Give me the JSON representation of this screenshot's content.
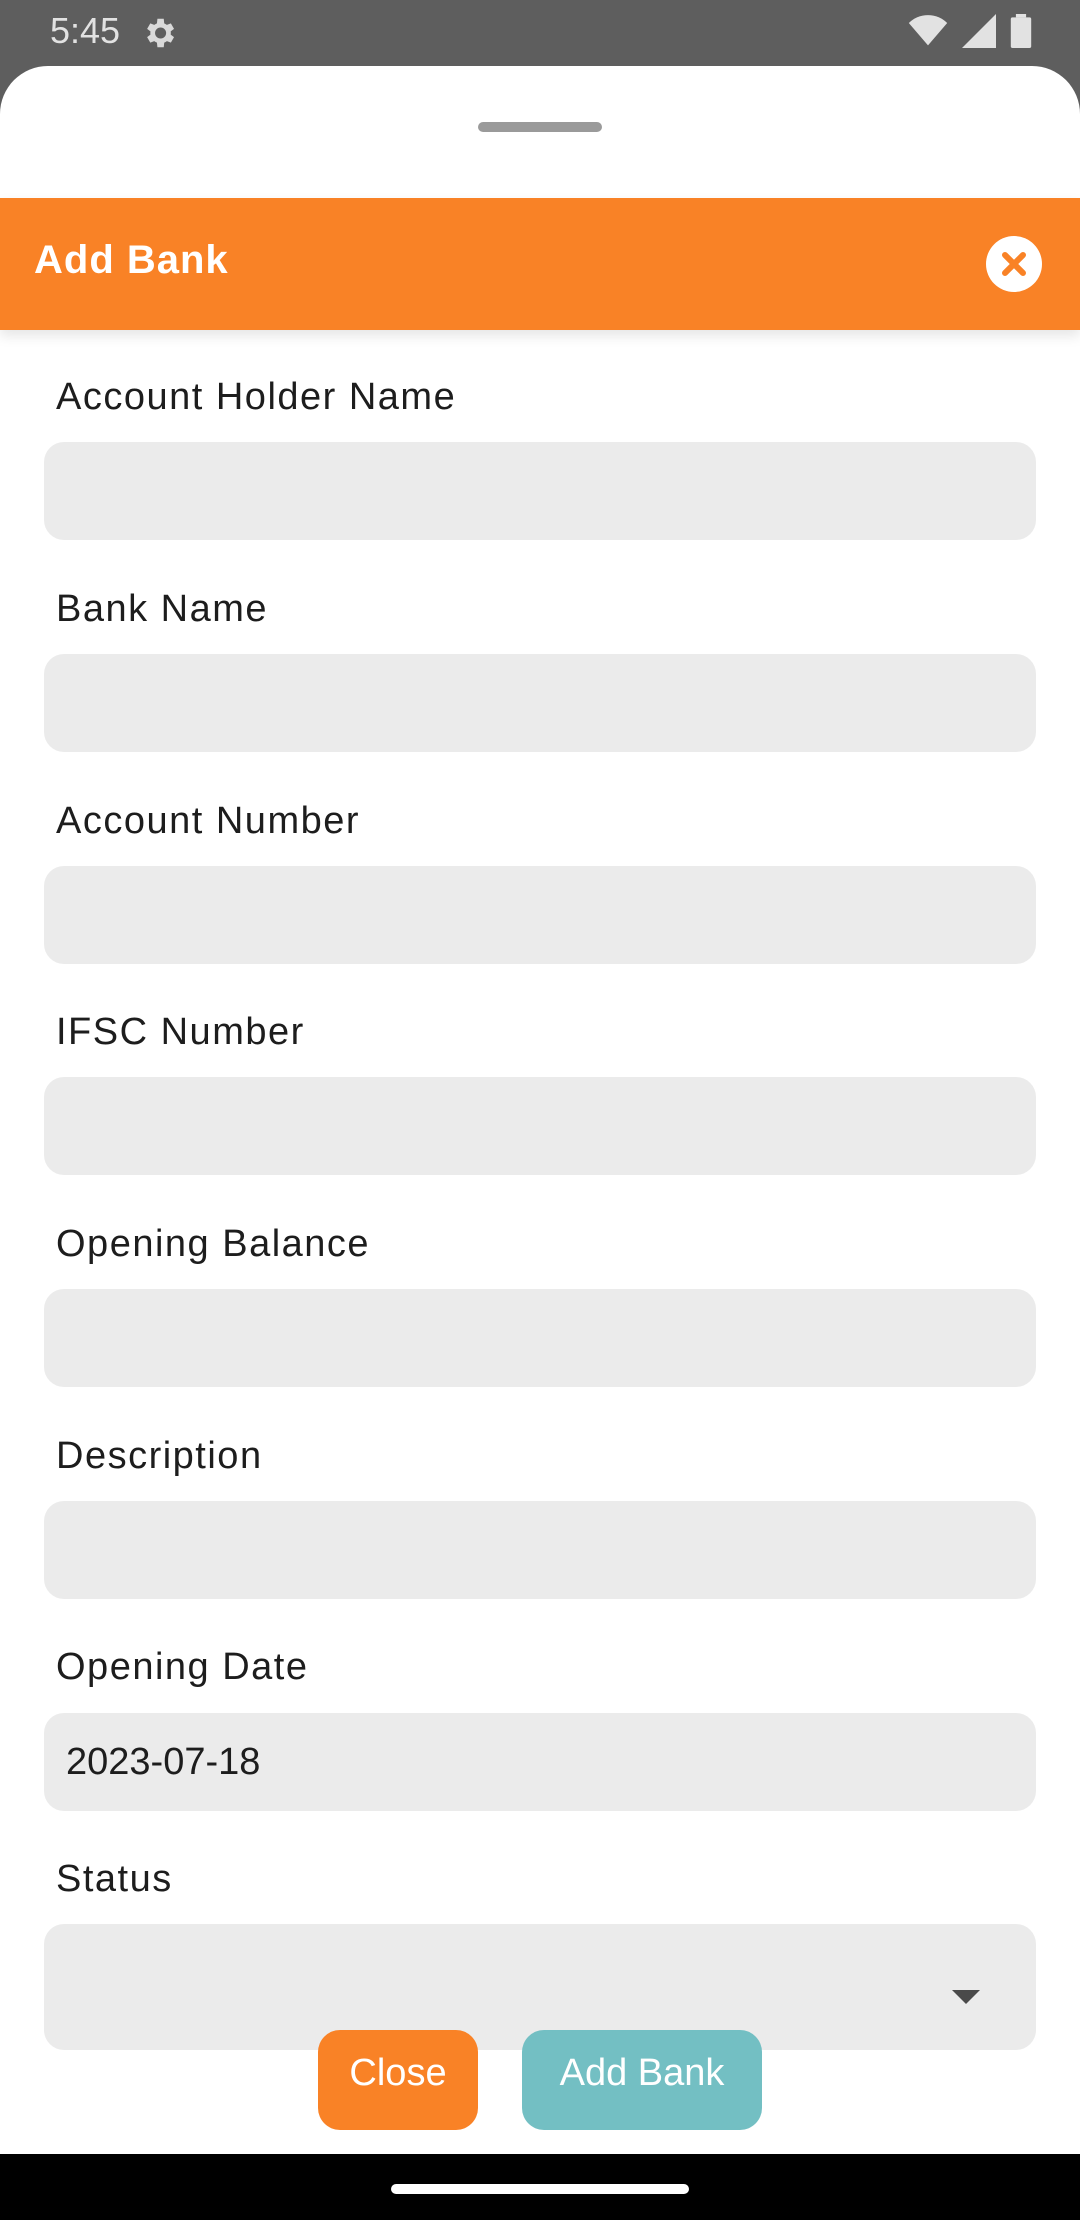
{
  "status_bar": {
    "time": "5:45",
    "icons": [
      "gear-icon",
      "wifi-icon",
      "signal-icon",
      "battery-icon"
    ]
  },
  "header": {
    "title": "Add Bank"
  },
  "form": {
    "account_holder_name": {
      "label": "Account Holder Name",
      "value": ""
    },
    "bank_name": {
      "label": "Bank Name",
      "value": ""
    },
    "account_number": {
      "label": "Account Number",
      "value": ""
    },
    "ifsc_number": {
      "label": "IFSC Number",
      "value": ""
    },
    "opening_balance": {
      "label": "Opening Balance",
      "value": ""
    },
    "description": {
      "label": "Description",
      "value": ""
    },
    "opening_date": {
      "label": "Opening Date",
      "value": "2023-07-18"
    },
    "status": {
      "label": "Status",
      "value": ""
    }
  },
  "actions": {
    "close_label": "Close",
    "add_label": "Add Bank"
  },
  "colors": {
    "accent": "#f98226",
    "secondary": "#73bfc3",
    "field_bg": "#ebebeb"
  }
}
